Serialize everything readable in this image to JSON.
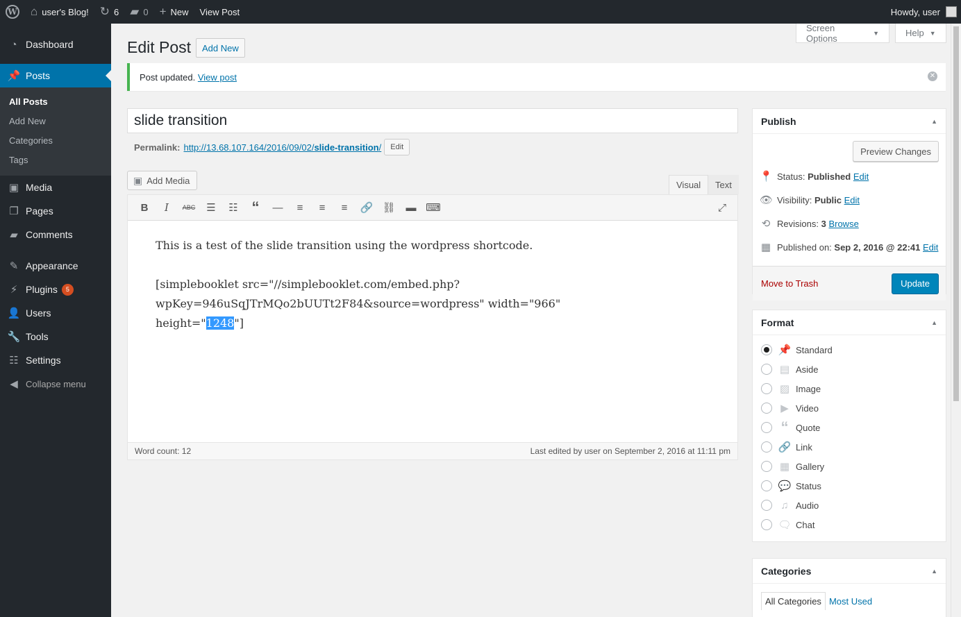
{
  "adminbar": {
    "site_name": "user's Blog!",
    "updates_count": "6",
    "comments_count": "0",
    "new_label": "New",
    "view_post_label": "View Post",
    "howdy": "Howdy, user"
  },
  "menu": {
    "dashboard": "Dashboard",
    "posts": "Posts",
    "posts_sub": [
      "All Posts",
      "Add New",
      "Categories",
      "Tags"
    ],
    "media": "Media",
    "pages": "Pages",
    "comments": "Comments",
    "appearance": "Appearance",
    "plugins": "Plugins",
    "plugins_badge": "5",
    "users": "Users",
    "tools": "Tools",
    "settings": "Settings",
    "collapse": "Collapse menu"
  },
  "screen_meta": {
    "screen_options": "Screen Options",
    "help": "Help"
  },
  "heading": {
    "title": "Edit Post",
    "add_new": "Add New"
  },
  "notice": {
    "text": "Post updated.",
    "link": "View post"
  },
  "post": {
    "title": "slide transition",
    "permalink_label": "Permalink:",
    "permalink_base": "http://13.68.107.164/2016/09/02/",
    "permalink_slug": "slide-transition",
    "permalink_end": "/",
    "edit_label": "Edit"
  },
  "editor": {
    "add_media": "Add Media",
    "tab_visual": "Visual",
    "tab_text": "Text",
    "paragraph1": "This is a test of the slide transition using the wordpress shortcode.",
    "shortcode_line1": "[simplebooklet src=\"//simplebooklet.com/embed.php?",
    "shortcode_line2": "wpKey=946uSqJTrMQo2bUUTt2F84&source=wordpress\" width=\"966\"",
    "shortcode_line3_pre": "height=\"",
    "shortcode_line3_sel": "1248",
    "shortcode_line3_post": "\"]",
    "word_count": "Word count: 12",
    "last_edited": "Last edited by user on September 2, 2016 at 11:11 pm"
  },
  "publish": {
    "title": "Publish",
    "preview": "Preview Changes",
    "status_label": "Status:",
    "status_value": "Published",
    "visibility_label": "Visibility:",
    "visibility_value": "Public",
    "revisions_label": "Revisions:",
    "revisions_value": "3",
    "browse": "Browse",
    "published_label": "Published on:",
    "published_value": "Sep 2, 2016 @ 22:41",
    "edit": "Edit",
    "trash": "Move to Trash",
    "update": "Update"
  },
  "format": {
    "title": "Format",
    "options": [
      "Standard",
      "Aside",
      "Image",
      "Video",
      "Quote",
      "Link",
      "Gallery",
      "Status",
      "Audio",
      "Chat"
    ],
    "selected": "Standard"
  },
  "categories": {
    "title": "Categories",
    "tab_all": "All Categories",
    "tab_most_used": "Most Used"
  },
  "colors": {
    "admin_bar": "#23282d",
    "accent": "#0073aa",
    "primary_button": "#0085ba",
    "notice_success": "#46b450",
    "trash": "#a00",
    "badge": "#d54e21"
  }
}
